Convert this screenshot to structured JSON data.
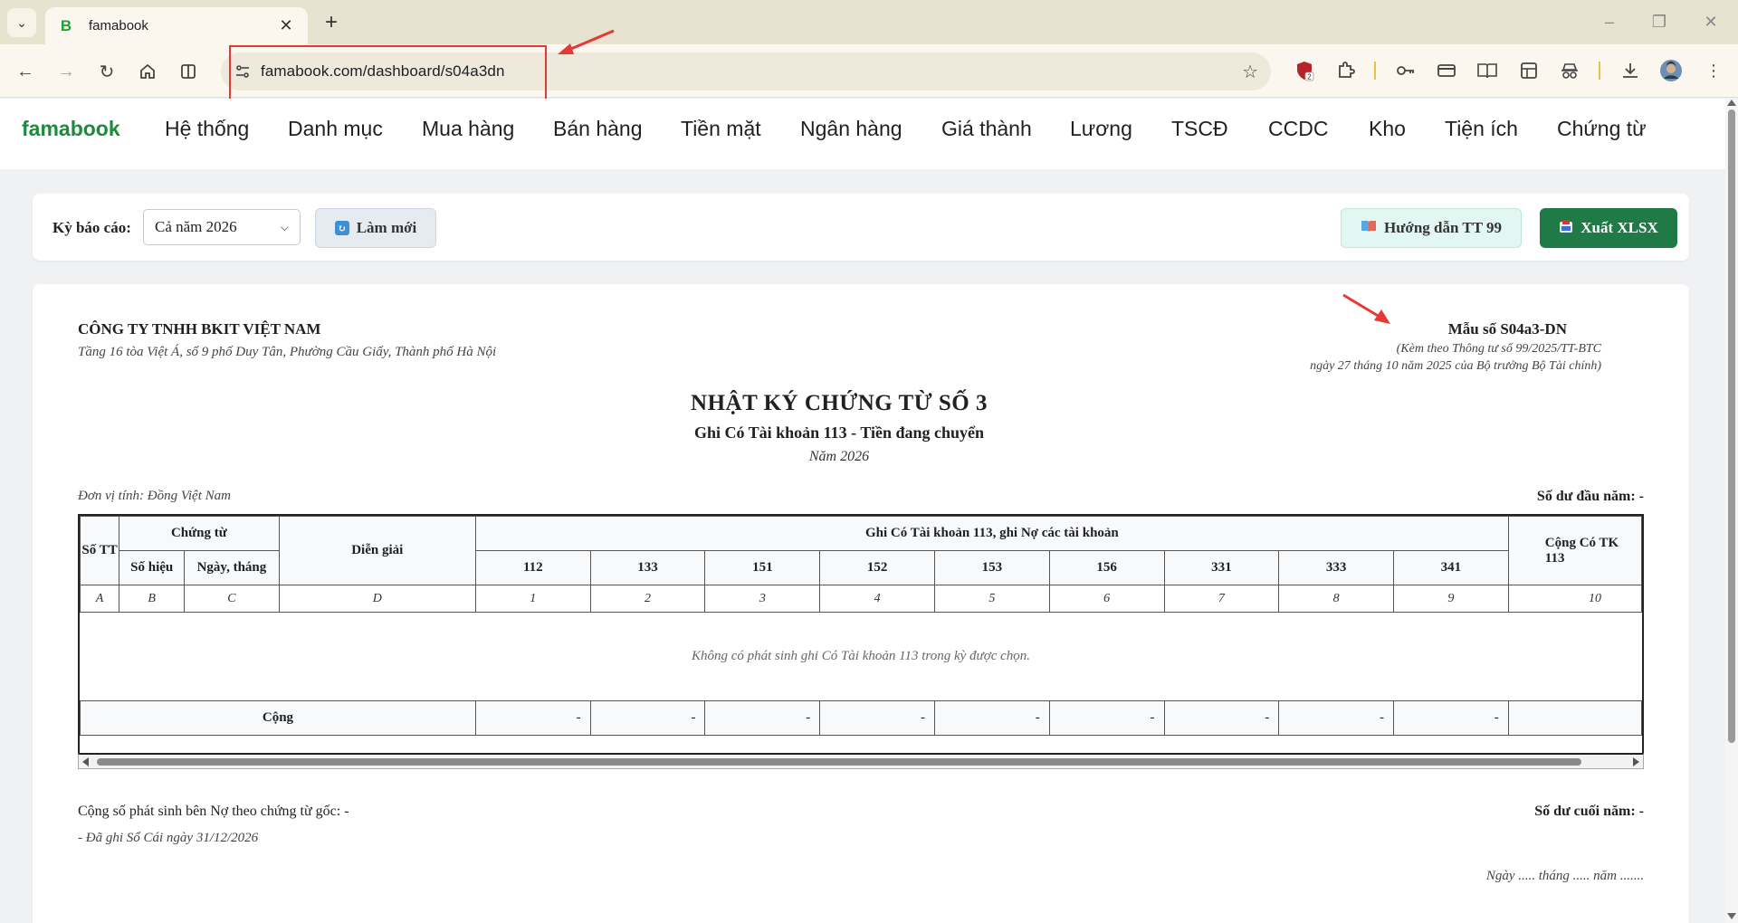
{
  "browser": {
    "tab_title": "famabook",
    "tab_favicon": "B",
    "url": "famabook.com/dashboard/s04a3dn",
    "extension_badge": "2"
  },
  "app": {
    "brand": "famabook",
    "menu": [
      "Hệ thống",
      "Danh mục",
      "Mua hàng",
      "Bán hàng",
      "Tiền mặt",
      "Ngân hàng",
      "Giá thành",
      "Lương",
      "TSCĐ",
      "CCDC",
      "Kho",
      "Tiện ích",
      "Chứng từ"
    ]
  },
  "filter": {
    "period_label": "Kỳ báo cáo:",
    "period_value": "Cả năm 2026",
    "refresh_label": "Làm mới",
    "guide_label": "Hướng dẫn TT 99",
    "export_label": "Xuất XLSX"
  },
  "report": {
    "company": "CÔNG TY TNHH BKIT VIỆT NAM",
    "address": "Tầng 16 tòa Việt Á, số 9 phố Duy Tân, Phường Cầu Giấy, Thành phố Hà Nội",
    "form_no": "Mẫu số S04a3-DN",
    "form_note_1": "(Kèm theo Thông tư số 99/2025/TT-BTC",
    "form_note_2": "ngày 27 tháng 10 năm 2025 của Bộ trưởng Bộ Tài chính)",
    "title": "NHẬT KÝ CHỨNG TỪ SỐ 3",
    "subtitle": "Ghi Có Tài khoản 113 - Tiền đang chuyển",
    "year": "Năm 2026",
    "unit": "Đơn vị tính: Đồng Việt Nam",
    "opening_balance": "Số dư đầu năm: -",
    "table": {
      "h_stt": "Số TT",
      "h_voucher": "Chứng từ",
      "h_voucher_no": "Số hiệu",
      "h_voucher_date": "Ngày, tháng",
      "h_desc": "Diễn giải",
      "h_group": "Ghi Có Tài khoản 113, ghi Nợ các tài khoản",
      "h_total": "Cộng Có TK 113",
      "accounts": [
        "112",
        "133",
        "151",
        "152",
        "153",
        "156",
        "331",
        "333",
        "341"
      ],
      "letters": [
        "A",
        "B",
        "C",
        "D",
        "1",
        "2",
        "3",
        "4",
        "5",
        "6",
        "7",
        "8",
        "9",
        "10"
      ],
      "empty_message": "Không có phát sinh ghi Có Tài khoản 113 trong kỳ được chọn.",
      "total_label": "Cộng",
      "total_values": [
        "-",
        "-",
        "-",
        "-",
        "-",
        "-",
        "-",
        "-",
        "-"
      ]
    },
    "total_debit": "Cộng số phát sinh bên Nợ theo chứng từ gốc: -",
    "closing_balance": "Số dư cuối năm: -",
    "ledger_note": "- Đã ghi Sổ Cái ngày 31/12/2026",
    "sign_date": "Ngày ..... tháng ..... năm ......."
  },
  "colors": {
    "brand_green": "#1c8b3c",
    "export_green": "#1f7a45",
    "annotation_red": "#e53935"
  }
}
